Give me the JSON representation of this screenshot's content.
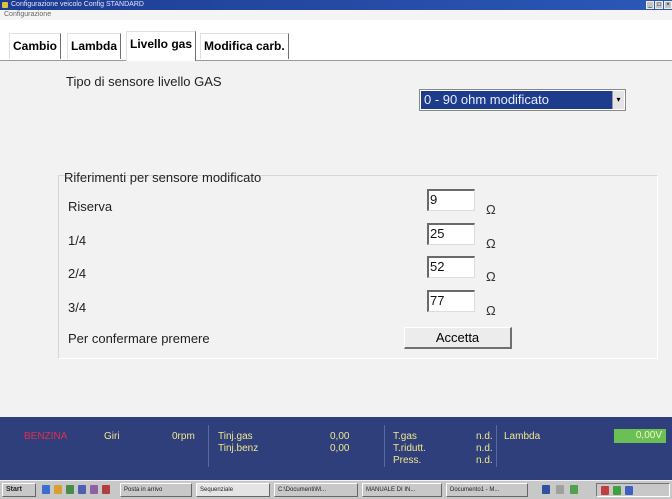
{
  "window": {
    "title": "Configurazione veicolo  Config STANDARD",
    "menu": "Configurazione"
  },
  "tabs": [
    {
      "label": "Cambio"
    },
    {
      "label": "Lambda"
    },
    {
      "label": "Livello gas",
      "active": true
    },
    {
      "label": "Modifica carb."
    }
  ],
  "main": {
    "sensor_type_label": "Tipo di sensore livello GAS",
    "sensor_type_value": "0 - 90 ohm modificato",
    "group_title": "Riferimenti per sensore modificato",
    "unit": "Ω",
    "rows": [
      {
        "label": "Riserva",
        "value": "9"
      },
      {
        "label": "1/4",
        "value": "25"
      },
      {
        "label": "2/4",
        "value": "52"
      },
      {
        "label": "3/4",
        "value": "77"
      }
    ],
    "confirm_label": "Per confermare premere",
    "accept_button": "Accetta"
  },
  "status": {
    "fuel": "BENZINA",
    "giri_label": "Giri",
    "giri_value": "0rpm",
    "tinj_gas_label": "Tinj.gas",
    "tinj_gas_value": "0,00",
    "tinj_benz_label": "Tinj.benz",
    "tinj_benz_value": "0,00",
    "tgas_label": "T.gas",
    "tgas_value": "n.d.",
    "tridutt_label": "T.ridutt.",
    "tridutt_value": "n.d.",
    "press_label": "Press.",
    "press_value": "n.d.",
    "lambda_label": "Lambda",
    "lambda_value": "0,00V"
  },
  "taskbar": {
    "start": "Start",
    "items": [
      "Posta in arrivo",
      "Sequenziale",
      "C:\\Documenti\\M...",
      "MANUALE DI IN...",
      "Documento1 - M..."
    ]
  },
  "colors": {
    "status_bg": "#2e3f7c",
    "status_text": "#f0e88c",
    "fuel_text": "#e0304a",
    "lambda_box": "#6abf55",
    "select_highlight": "#1e3c8c"
  }
}
